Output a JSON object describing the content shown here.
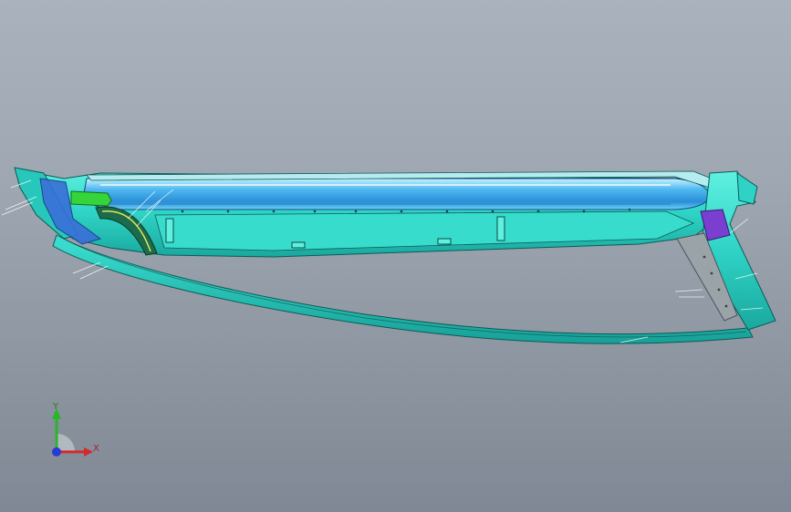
{
  "viewport": {
    "background_top": "#a9b2bd",
    "background_bottom": "#7f8894"
  },
  "model": {
    "icon": "cad-assembly-model",
    "colors": {
      "shell": "#2fd3c6",
      "shell_edge": "#0d5a55",
      "tube": "#3aa8e8",
      "tube_highlight": "#9fe3ff",
      "accent_green": "#35d43a",
      "clip_dark": "#1c6b4a",
      "bracket_purple": "#7a3fd0",
      "pointer_blue": "#2c6ad8"
    }
  },
  "triad": {
    "x_label": "X",
    "y_label": "Y",
    "x_color": "#d42a2a",
    "y_color": "#2ab52a",
    "z_color": "#2a3ad4"
  }
}
